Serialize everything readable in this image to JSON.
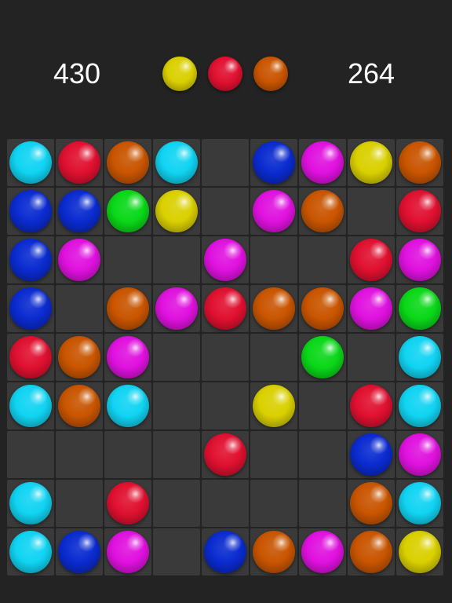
{
  "colors": {
    "cyan": "#10d4f2",
    "red": "#e01030",
    "orange": "#c95500",
    "blue": "#0a2bd0",
    "magenta": "#e011df",
    "yellow": "#dad000",
    "green": "#0ad818",
    "background": "#232323",
    "cell": "#3a3a3a"
  },
  "header": {
    "score_left": "430",
    "score_right": "264",
    "next_balls": [
      "yellow",
      "red",
      "orange"
    ]
  },
  "board": {
    "rows": [
      [
        "cyan",
        "red",
        "orange",
        "cyan",
        null,
        "blue",
        "magenta",
        "yellow",
        "orange"
      ],
      [
        "blue",
        "blue",
        "green",
        "yellow",
        null,
        "magenta",
        "orange",
        null,
        "red"
      ],
      [
        "blue",
        "magenta",
        null,
        null,
        "magenta",
        null,
        null,
        "red",
        "magenta"
      ],
      [
        "blue",
        null,
        "orange",
        "magenta",
        "red",
        "orange",
        "orange",
        "magenta",
        "green"
      ],
      [
        "red",
        "orange",
        "magenta",
        null,
        null,
        null,
        "green",
        null,
        "cyan"
      ],
      [
        "cyan",
        "orange",
        "cyan",
        null,
        null,
        "yellow",
        null,
        "red",
        "cyan"
      ],
      [
        null,
        null,
        null,
        null,
        "red",
        null,
        null,
        "blue",
        "magenta"
      ],
      [
        "cyan",
        null,
        "red",
        null,
        null,
        null,
        null,
        "orange",
        "cyan"
      ],
      [
        "cyan",
        "blue",
        "magenta",
        null,
        "blue",
        "orange",
        "magenta",
        "orange",
        "yellow"
      ]
    ]
  }
}
